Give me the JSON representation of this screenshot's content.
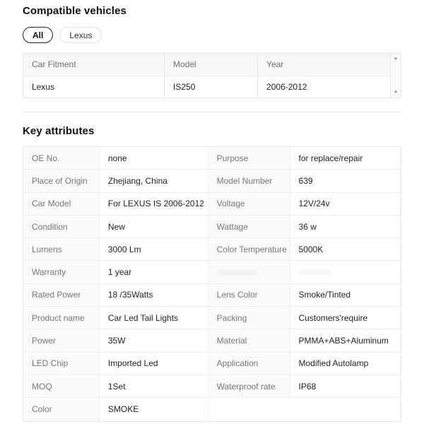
{
  "colors": {
    "pill_selected_border": "#1f1f1f",
    "table_border": "#e6e6e6",
    "header_bg": "#f7f7f7",
    "label_bg": "#fafafa",
    "label_text": "#767676",
    "value_text": "#222222"
  },
  "compatible_vehicles": {
    "title": "Compatible vehicles",
    "filters": [
      {
        "label": "All",
        "selected": true
      },
      {
        "label": "Lexus",
        "selected": false
      }
    ],
    "table": {
      "columns": [
        "Car Fitment",
        "Model",
        "Year"
      ],
      "rows": [
        [
          "Lexus",
          "IS250",
          "2006-2012"
        ]
      ]
    },
    "scrollbar": {
      "up_icon": "▲",
      "down_icon": "▼"
    }
  },
  "key_attributes": {
    "title": "Key attributes",
    "rows": [
      [
        {
          "label": "OE No.",
          "value": "none"
        },
        {
          "label": "Purpose",
          "value": "for replace/repair"
        }
      ],
      [
        {
          "label": "Place of Origin",
          "value": "Zhejiang, China"
        },
        {
          "label": "Model Number",
          "value": "639"
        }
      ],
      [
        {
          "label": "Car Model",
          "value": "For LEXUS IS 2006-2012"
        },
        {
          "label": "Voltage",
          "value": "12V/24v"
        }
      ],
      [
        {
          "label": "Condition",
          "value": "New"
        },
        {
          "label": "Wattage",
          "value": "36 w"
        }
      ],
      [
        {
          "label": "Lumens",
          "value": "3000 Lm"
        },
        {
          "label": "Color Temperature",
          "value": "5000K"
        }
      ],
      [
        {
          "label": "Warranty",
          "value": "1 year"
        },
        {
          "label": "",
          "value": "",
          "faded": true
        }
      ],
      [
        {
          "label": "Rated Power",
          "value": "18 /35Watts"
        },
        {
          "label": "Lens Color",
          "value": "Smoke/Tinted"
        }
      ],
      [
        {
          "label": "Product name",
          "value": "Car Led Tail Lights"
        },
        {
          "label": "Packing",
          "value": "Customers'require"
        }
      ],
      [
        {
          "label": "Power",
          "value": "35W"
        },
        {
          "label": "Material",
          "value": "PMMA+ABS+Aluminum"
        }
      ],
      [
        {
          "label": "LED Chip",
          "value": "Imported Led"
        },
        {
          "label": "Application",
          "value": "Modified Autolamp"
        }
      ],
      [
        {
          "label": "MOQ",
          "value": "1Set"
        },
        {
          "label": "Waterproof rate",
          "value": "IP68"
        }
      ],
      [
        {
          "label": "Color",
          "value": "SMOKE"
        },
        {
          "label": "",
          "value": "",
          "empty": true
        }
      ]
    ]
  }
}
